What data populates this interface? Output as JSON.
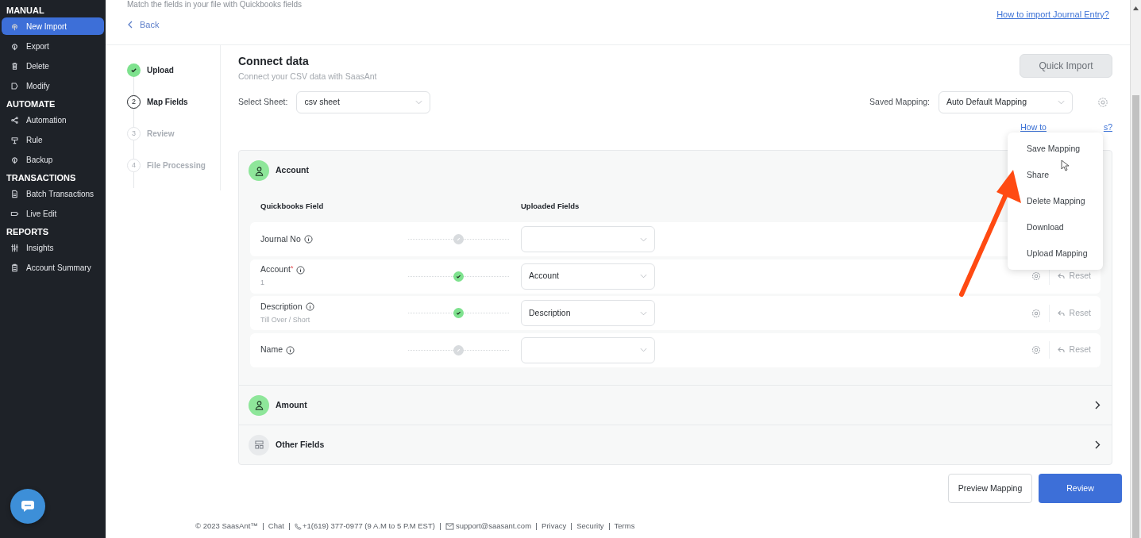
{
  "sidebar": {
    "sections": [
      {
        "heading": "MANUAL",
        "items": [
          {
            "label": "New Import",
            "selected": true
          },
          {
            "label": "Export",
            "selected": false
          },
          {
            "label": "Delete",
            "selected": false
          },
          {
            "label": "Modify",
            "selected": false
          }
        ]
      },
      {
        "heading": "AUTOMATE",
        "items": [
          {
            "label": "Automation",
            "selected": false
          },
          {
            "label": "Rule",
            "selected": false
          },
          {
            "label": "Backup",
            "selected": false
          }
        ]
      },
      {
        "heading": "TRANSACTIONS",
        "items": [
          {
            "label": "Batch Transactions",
            "selected": false
          },
          {
            "label": "Live Edit",
            "selected": false
          }
        ]
      },
      {
        "heading": "REPORTS",
        "items": [
          {
            "label": "Insights",
            "selected": false
          },
          {
            "label": "Account Summary",
            "selected": false
          }
        ]
      }
    ]
  },
  "header": {
    "subtitle": "Match the fields in your file with Quickbooks fields",
    "back": "Back",
    "help_link": "How to import Journal Entry?"
  },
  "steps": [
    {
      "label": "Upload",
      "completed": true,
      "selected": false
    },
    {
      "number": "2",
      "label": "Map Fields",
      "completed": false,
      "selected": true
    },
    {
      "number": "3",
      "label": "Review",
      "completed": false,
      "selected": false
    },
    {
      "number": "4",
      "label": "File Processing",
      "completed": false,
      "selected": false
    }
  ],
  "connect": {
    "title": "Connect data",
    "subtitle": "Connect your CSV data with SaasAnt",
    "sheet_label": "Select Sheet:",
    "sheet_value": "csv sheet",
    "quick_import": "Quick Import",
    "mapping_label": "Saved Mapping:",
    "mapping_value": "Auto Default Mapping",
    "mapping_help_start": "How to",
    "mapping_help_end": "s?"
  },
  "sections": [
    {
      "title": "Account",
      "expanded": true,
      "done": true,
      "columns": [
        "Quickbooks Field",
        "Uploaded Fields"
      ],
      "rows": [
        {
          "field": "Journal No",
          "mapped": false
        },
        {
          "field": "Account",
          "required_mark": "*",
          "hint": "1",
          "mapped": true,
          "value": "Account",
          "reset": "Reset"
        },
        {
          "field": "Description",
          "hint": "Till Over / Short",
          "mapped": true,
          "value": "Description",
          "reset": "Reset"
        },
        {
          "field": "Name",
          "mapped": false,
          "reset": "Reset"
        }
      ]
    },
    {
      "title": "Amount",
      "expanded": false,
      "done": true
    },
    {
      "title": "Other Fields",
      "expanded": false,
      "done": false
    }
  ],
  "menu": {
    "items": [
      "Save Mapping",
      "Share",
      "Delete Mapping",
      "Download",
      "Upload Mapping"
    ]
  },
  "actions": {
    "preview": "Preview Mapping",
    "review": "Review"
  },
  "footer": [
    {
      "kind": "text",
      "text": "© 2023 SaasAnt™"
    },
    {
      "kind": "link",
      "text": "Chat"
    },
    {
      "kind": "phone",
      "text": "+1(619) 377-0977 (9 A.M to 5 P.M EST)"
    },
    {
      "kind": "email",
      "text": "support@saasant.com"
    },
    {
      "kind": "link",
      "text": "Privacy"
    },
    {
      "kind": "link",
      "text": "Security"
    },
    {
      "kind": "link",
      "text": "Terms"
    }
  ]
}
